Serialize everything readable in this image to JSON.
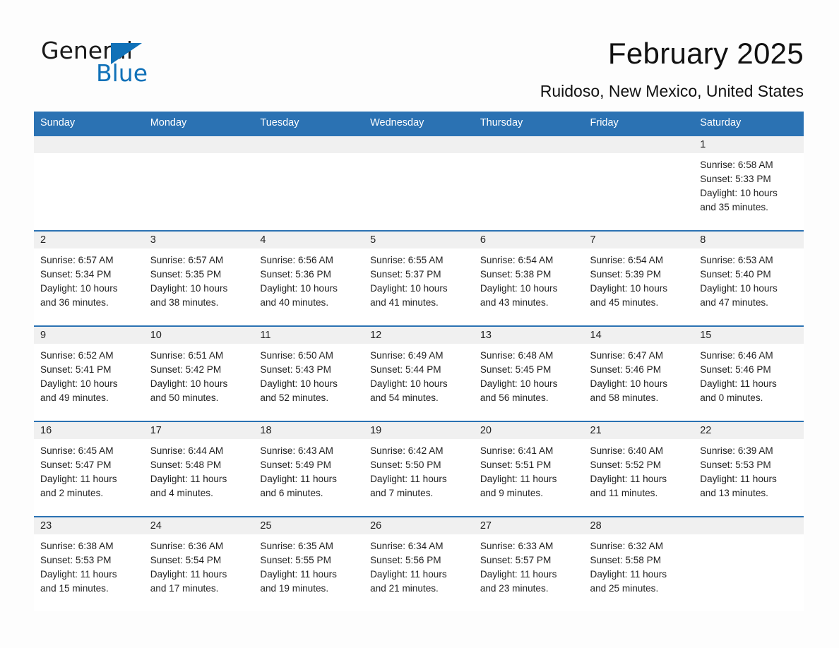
{
  "brand": {
    "name_part1": "General",
    "name_part2": "Blue",
    "accent_color": "#1071b8"
  },
  "header": {
    "title": "February 2025",
    "subtitle": "Ruidoso, New Mexico, United States"
  },
  "theme": {
    "header_bg": "#2b72b3",
    "daynum_bg": "#f0f0f0",
    "page_bg": "#fdfdfd"
  },
  "calendar": {
    "weekday_headers": [
      "Sunday",
      "Monday",
      "Tuesday",
      "Wednesday",
      "Thursday",
      "Friday",
      "Saturday"
    ],
    "weeks": [
      [
        {
          "blank": true
        },
        {
          "blank": true
        },
        {
          "blank": true
        },
        {
          "blank": true
        },
        {
          "blank": true
        },
        {
          "blank": true
        },
        {
          "day": "1",
          "sunrise": "Sunrise: 6:58 AM",
          "sunset": "Sunset: 5:33 PM",
          "daylight_line1": "Daylight: 10 hours",
          "daylight_line2": "and 35 minutes."
        }
      ],
      [
        {
          "day": "2",
          "sunrise": "Sunrise: 6:57 AM",
          "sunset": "Sunset: 5:34 PM",
          "daylight_line1": "Daylight: 10 hours",
          "daylight_line2": "and 36 minutes."
        },
        {
          "day": "3",
          "sunrise": "Sunrise: 6:57 AM",
          "sunset": "Sunset: 5:35 PM",
          "daylight_line1": "Daylight: 10 hours",
          "daylight_line2": "and 38 minutes."
        },
        {
          "day": "4",
          "sunrise": "Sunrise: 6:56 AM",
          "sunset": "Sunset: 5:36 PM",
          "daylight_line1": "Daylight: 10 hours",
          "daylight_line2": "and 40 minutes."
        },
        {
          "day": "5",
          "sunrise": "Sunrise: 6:55 AM",
          "sunset": "Sunset: 5:37 PM",
          "daylight_line1": "Daylight: 10 hours",
          "daylight_line2": "and 41 minutes."
        },
        {
          "day": "6",
          "sunrise": "Sunrise: 6:54 AM",
          "sunset": "Sunset: 5:38 PM",
          "daylight_line1": "Daylight: 10 hours",
          "daylight_line2": "and 43 minutes."
        },
        {
          "day": "7",
          "sunrise": "Sunrise: 6:54 AM",
          "sunset": "Sunset: 5:39 PM",
          "daylight_line1": "Daylight: 10 hours",
          "daylight_line2": "and 45 minutes."
        },
        {
          "day": "8",
          "sunrise": "Sunrise: 6:53 AM",
          "sunset": "Sunset: 5:40 PM",
          "daylight_line1": "Daylight: 10 hours",
          "daylight_line2": "and 47 minutes."
        }
      ],
      [
        {
          "day": "9",
          "sunrise": "Sunrise: 6:52 AM",
          "sunset": "Sunset: 5:41 PM",
          "daylight_line1": "Daylight: 10 hours",
          "daylight_line2": "and 49 minutes."
        },
        {
          "day": "10",
          "sunrise": "Sunrise: 6:51 AM",
          "sunset": "Sunset: 5:42 PM",
          "daylight_line1": "Daylight: 10 hours",
          "daylight_line2": "and 50 minutes."
        },
        {
          "day": "11",
          "sunrise": "Sunrise: 6:50 AM",
          "sunset": "Sunset: 5:43 PM",
          "daylight_line1": "Daylight: 10 hours",
          "daylight_line2": "and 52 minutes."
        },
        {
          "day": "12",
          "sunrise": "Sunrise: 6:49 AM",
          "sunset": "Sunset: 5:44 PM",
          "daylight_line1": "Daylight: 10 hours",
          "daylight_line2": "and 54 minutes."
        },
        {
          "day": "13",
          "sunrise": "Sunrise: 6:48 AM",
          "sunset": "Sunset: 5:45 PM",
          "daylight_line1": "Daylight: 10 hours",
          "daylight_line2": "and 56 minutes."
        },
        {
          "day": "14",
          "sunrise": "Sunrise: 6:47 AM",
          "sunset": "Sunset: 5:46 PM",
          "daylight_line1": "Daylight: 10 hours",
          "daylight_line2": "and 58 minutes."
        },
        {
          "day": "15",
          "sunrise": "Sunrise: 6:46 AM",
          "sunset": "Sunset: 5:46 PM",
          "daylight_line1": "Daylight: 11 hours",
          "daylight_line2": "and 0 minutes."
        }
      ],
      [
        {
          "day": "16",
          "sunrise": "Sunrise: 6:45 AM",
          "sunset": "Sunset: 5:47 PM",
          "daylight_line1": "Daylight: 11 hours",
          "daylight_line2": "and 2 minutes."
        },
        {
          "day": "17",
          "sunrise": "Sunrise: 6:44 AM",
          "sunset": "Sunset: 5:48 PM",
          "daylight_line1": "Daylight: 11 hours",
          "daylight_line2": "and 4 minutes."
        },
        {
          "day": "18",
          "sunrise": "Sunrise: 6:43 AM",
          "sunset": "Sunset: 5:49 PM",
          "daylight_line1": "Daylight: 11 hours",
          "daylight_line2": "and 6 minutes."
        },
        {
          "day": "19",
          "sunrise": "Sunrise: 6:42 AM",
          "sunset": "Sunset: 5:50 PM",
          "daylight_line1": "Daylight: 11 hours",
          "daylight_line2": "and 7 minutes."
        },
        {
          "day": "20",
          "sunrise": "Sunrise: 6:41 AM",
          "sunset": "Sunset: 5:51 PM",
          "daylight_line1": "Daylight: 11 hours",
          "daylight_line2": "and 9 minutes."
        },
        {
          "day": "21",
          "sunrise": "Sunrise: 6:40 AM",
          "sunset": "Sunset: 5:52 PM",
          "daylight_line1": "Daylight: 11 hours",
          "daylight_line2": "and 11 minutes."
        },
        {
          "day": "22",
          "sunrise": "Sunrise: 6:39 AM",
          "sunset": "Sunset: 5:53 PM",
          "daylight_line1": "Daylight: 11 hours",
          "daylight_line2": "and 13 minutes."
        }
      ],
      [
        {
          "day": "23",
          "sunrise": "Sunrise: 6:38 AM",
          "sunset": "Sunset: 5:53 PM",
          "daylight_line1": "Daylight: 11 hours",
          "daylight_line2": "and 15 minutes."
        },
        {
          "day": "24",
          "sunrise": "Sunrise: 6:36 AM",
          "sunset": "Sunset: 5:54 PM",
          "daylight_line1": "Daylight: 11 hours",
          "daylight_line2": "and 17 minutes."
        },
        {
          "day": "25",
          "sunrise": "Sunrise: 6:35 AM",
          "sunset": "Sunset: 5:55 PM",
          "daylight_line1": "Daylight: 11 hours",
          "daylight_line2": "and 19 minutes."
        },
        {
          "day": "26",
          "sunrise": "Sunrise: 6:34 AM",
          "sunset": "Sunset: 5:56 PM",
          "daylight_line1": "Daylight: 11 hours",
          "daylight_line2": "and 21 minutes."
        },
        {
          "day": "27",
          "sunrise": "Sunrise: 6:33 AM",
          "sunset": "Sunset: 5:57 PM",
          "daylight_line1": "Daylight: 11 hours",
          "daylight_line2": "and 23 minutes."
        },
        {
          "day": "28",
          "sunrise": "Sunrise: 6:32 AM",
          "sunset": "Sunset: 5:58 PM",
          "daylight_line1": "Daylight: 11 hours",
          "daylight_line2": "and 25 minutes."
        },
        {
          "blank": true
        }
      ]
    ]
  }
}
